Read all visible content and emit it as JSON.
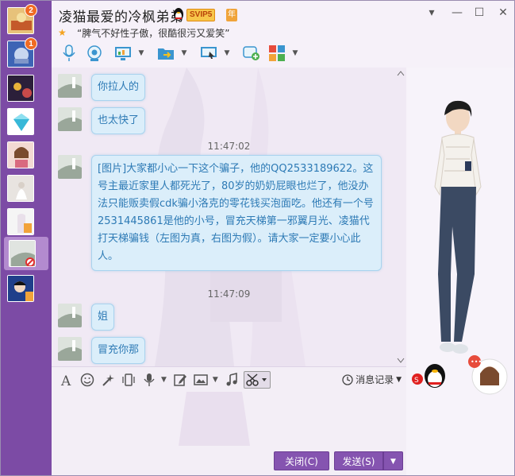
{
  "window": {
    "title": "凌猫最爱的冷枫弟弟",
    "vip_label": "SVIP5",
    "year_label": "年",
    "signature": "“脾气不好性子傲，很酷很污又爱笑”",
    "controls": {
      "menu": "▾",
      "minimize": "—",
      "maximize": "☐",
      "close": "✕"
    }
  },
  "sidebar": {
    "sessions": [
      {
        "badge": "2"
      },
      {
        "badge": "1"
      },
      {
        "badge": ""
      },
      {
        "badge": ""
      },
      {
        "badge": ""
      },
      {
        "badge": ""
      },
      {
        "badge": ""
      },
      {
        "badge": ""
      },
      {
        "badge": ""
      }
    ]
  },
  "toolbar_top": {
    "icons": [
      "voice-call-icon",
      "video-call-icon",
      "screen-share-icon",
      "file-transfer-icon",
      "remote-desktop-icon",
      "add-contact-icon",
      "apps-icon"
    ]
  },
  "chat": {
    "messages": [
      {
        "text": "你拉人的"
      },
      {
        "text": "也太快了"
      },
      {
        "timestamp": "11:47:02"
      },
      {
        "text": "[图片]大家都小心一下这个骗子，他的QQ2533189622。这号主最近家里人都死光了，80岁的奶奶屁眼也烂了，他没办法只能贩卖假cdk骗小洛克的零花钱买泡面吃。他还有一个号2531445861是他的小号，冒充天梯第一邪翼月光、凌猫代打天梯骗钱（左图为真，右图为假）。请大家一定要小心此人。"
      },
      {
        "timestamp": "11:47:09"
      },
      {
        "text": "姐"
      },
      {
        "text": "冒充你那"
      }
    ]
  },
  "input_toolbar": {
    "icons": [
      "font-icon",
      "emoji-icon",
      "magic-icon",
      "vibrate-icon",
      "voice-message-icon",
      "edit-icon",
      "image-icon",
      "music-icon",
      "screenshot-icon"
    ],
    "history_label": "消息记录"
  },
  "buttons": {
    "close_label": "关闭(C)",
    "send_label": "发送(S)"
  },
  "colors": {
    "sidebar": "#7c4ba5",
    "button": "#8554b0",
    "bubble_bg": "#dbeefa",
    "bubble_text": "#2d7ab5"
  }
}
